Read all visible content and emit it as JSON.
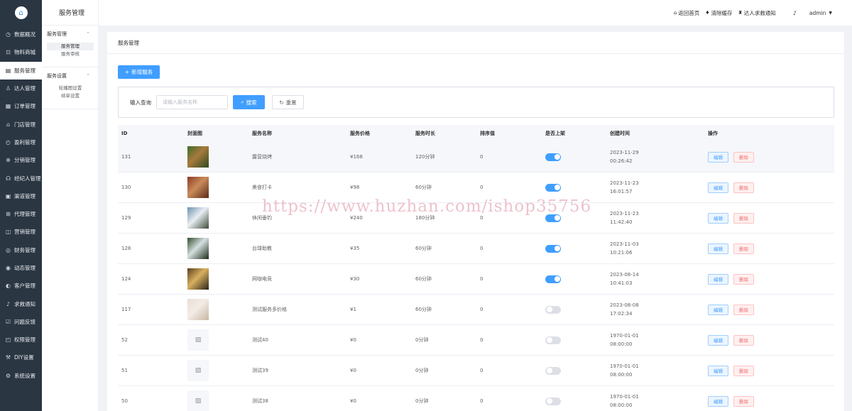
{
  "sidebar": {
    "items": [
      {
        "label": "数据概况",
        "icon": "dashboard-icon",
        "glyph": "◷"
      },
      {
        "label": "物料商城",
        "icon": "cart-icon",
        "glyph": "⊡"
      },
      {
        "label": "服务管理",
        "icon": "service-icon",
        "glyph": "▤"
      },
      {
        "label": "达人管理",
        "icon": "user-icon",
        "glyph": "♙"
      },
      {
        "label": "订单管理",
        "icon": "order-icon",
        "glyph": "▦"
      },
      {
        "label": "门店管理",
        "icon": "store-icon",
        "glyph": "⌂"
      },
      {
        "label": "盈利管理",
        "icon": "profit-icon",
        "glyph": "◴"
      },
      {
        "label": "分销管理",
        "icon": "share-icon",
        "glyph": "⊕"
      },
      {
        "label": "经纪人管理",
        "icon": "agent-icon",
        "glyph": "☊"
      },
      {
        "label": "渠道管理",
        "icon": "channel-icon",
        "glyph": "▣"
      },
      {
        "label": "代理管理",
        "icon": "proxy-icon",
        "glyph": "⊞"
      },
      {
        "label": "营销管理",
        "icon": "marketing-icon",
        "glyph": "◫"
      },
      {
        "label": "财务管理",
        "icon": "finance-icon",
        "glyph": "◎"
      },
      {
        "label": "动态管理",
        "icon": "feed-icon",
        "glyph": "◉"
      },
      {
        "label": "客户管理",
        "icon": "customer-icon",
        "glyph": "◐"
      },
      {
        "label": "求救通知",
        "icon": "bell-icon",
        "glyph": "♪"
      },
      {
        "label": "问题反馈",
        "icon": "feedback-icon",
        "glyph": "☑"
      },
      {
        "label": "权限管理",
        "icon": "permission-icon",
        "glyph": "◰"
      },
      {
        "label": "DIY设置",
        "icon": "diy-icon",
        "glyph": "⚒"
      },
      {
        "label": "系统设置",
        "icon": "settings-icon",
        "glyph": "⚙"
      }
    ]
  },
  "subnav": {
    "title": "服务管理",
    "groups": [
      {
        "title": "服务管理",
        "links": [
          "服务管理",
          "服务审核"
        ]
      },
      {
        "title": "服务设置",
        "links": [
          "轮播图设置",
          "续单设置"
        ]
      }
    ]
  },
  "header": {
    "home": "返回首页",
    "clear_cache": "清除缓存",
    "sos_notice": "达人求救通知",
    "user": "admin"
  },
  "page": {
    "title": "服务管理",
    "add_button": "新增服务",
    "filter_label": "输入查询",
    "search_placeholder": "请输入服务名称",
    "search_button": "搜索",
    "reset_button": "重置"
  },
  "table": {
    "columns": [
      "ID",
      "封面图",
      "服务名称",
      "服务价格",
      "服务时长",
      "排序值",
      "是否上架",
      "创建时间",
      "操作"
    ],
    "edit_label": "编辑",
    "delete_label": "删除",
    "rows": [
      {
        "id": "131",
        "name": "露营烧烤",
        "price": "¥168",
        "duration": "120分钟",
        "sort": "0",
        "listed": true,
        "date": "2023-11-29",
        "time": "00:26:42",
        "has_image": true,
        "img": [
          "#3f6b2a",
          "#a77a3c",
          "#2c4a1e"
        ]
      },
      {
        "id": "130",
        "name": "美食打卡",
        "price": "¥98",
        "duration": "60分钟",
        "sort": "0",
        "listed": true,
        "date": "2023-11-23",
        "time": "16:01:57",
        "has_image": true,
        "img": [
          "#8a3a24",
          "#c98b5a",
          "#5a2a18"
        ]
      },
      {
        "id": "129",
        "name": "休闲垂钓",
        "price": "¥240",
        "duration": "180分钟",
        "sort": "0",
        "listed": true,
        "date": "2023-11-23",
        "time": "11:42:40",
        "has_image": true,
        "img": [
          "#6e8fae",
          "#e9eef2",
          "#3d4a3a"
        ]
      },
      {
        "id": "128",
        "name": "台球助教",
        "price": "¥35",
        "duration": "60分钟",
        "sort": "0",
        "listed": true,
        "date": "2023-11-03",
        "time": "10:21:06",
        "has_image": true,
        "img": [
          "#2f4d2c",
          "#d5dfe0",
          "#1c2b1a"
        ]
      },
      {
        "id": "124",
        "name": "网咖电竞",
        "price": "¥30",
        "duration": "60分钟",
        "sort": "0",
        "listed": true,
        "date": "2023-08-14",
        "time": "10:41:03",
        "has_image": true,
        "img": [
          "#5b3e1f",
          "#d8b060",
          "#2a2418"
        ]
      },
      {
        "id": "117",
        "name": "测试服务多价格",
        "price": "¥1",
        "duration": "60分钟",
        "sort": "0",
        "listed": false,
        "date": "2023-08-08",
        "time": "17:02:34",
        "has_image": true,
        "img": [
          "#e8ddd3",
          "#f3ece6",
          "#c9b6a4"
        ]
      },
      {
        "id": "52",
        "name": "测试40",
        "price": "¥0",
        "duration": "0分钟",
        "sort": "0",
        "listed": false,
        "date": "1970-01-01",
        "time": "08:00:00",
        "has_image": false
      },
      {
        "id": "51",
        "name": "测试39",
        "price": "¥0",
        "duration": "0分钟",
        "sort": "0",
        "listed": false,
        "date": "1970-01-01",
        "time": "08:00:00",
        "has_image": false
      },
      {
        "id": "50",
        "name": "测试38",
        "price": "¥0",
        "duration": "0分钟",
        "sort": "0",
        "listed": false,
        "date": "1970-01-01",
        "time": "08:00:00",
        "has_image": false
      }
    ]
  },
  "watermark": "https://www.huzhan.com/ishop35756"
}
